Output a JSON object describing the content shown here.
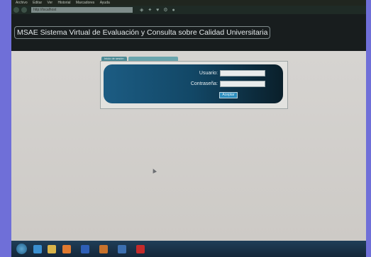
{
  "browser": {
    "menu": [
      "Archivo",
      "Editar",
      "Ver",
      "Historial",
      "Marcadores",
      "Ayuda"
    ],
    "url": "http://localhost"
  },
  "site": {
    "title": "MSAE Sistema Virtual de Evaluación y Consulta sobre Calidad Universitaria"
  },
  "login": {
    "tabs": [
      "Inicio de sesión",
      ""
    ],
    "user_label": "Usuario:",
    "password_label": "Contraseña:",
    "user_value": "",
    "password_value": "",
    "submit_label": "Aceptar"
  },
  "taskbar": {
    "icons": [
      "start-icon",
      "ie-icon",
      "folder-icon",
      "media-icon",
      "word-icon",
      "explorer-icon",
      "firefox-icon",
      "acrobat-icon"
    ],
    "colors": {
      "bg": "#1b3449"
    }
  },
  "colors": {
    "header_bg": "#181d1e",
    "panel_accent": "#1c5c83",
    "page_bg": "#d6d4d1"
  }
}
